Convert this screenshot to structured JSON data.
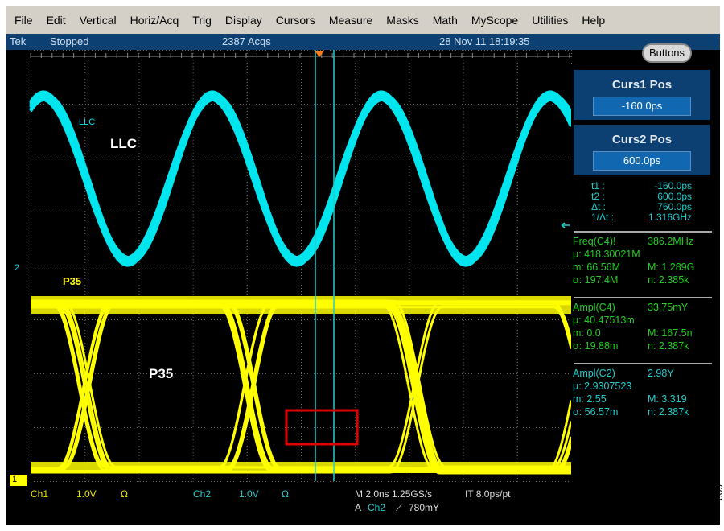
{
  "menu": [
    "File",
    "Edit",
    "Vertical",
    "Horiz/Acq",
    "Trig",
    "Display",
    "Cursors",
    "Measure",
    "Masks",
    "Math",
    "MyScope",
    "Utilities",
    "Help"
  ],
  "status": {
    "brand": "Tek",
    "state": "Stopped",
    "acqs": "2387 Acqs",
    "datetime": "28 Nov 11 18:19:35"
  },
  "buttons_label": "Buttons",
  "cursors": {
    "c1_title": "Curs1 Pos",
    "c1_value": "-160.0ps",
    "c2_title": "Curs2 Pos",
    "c2_value": "600.0ps",
    "readout": [
      [
        "t1 :",
        "-160.0ps"
      ],
      [
        "t2 :",
        "600.0ps"
      ],
      [
        "Δt :",
        "760.0ps"
      ],
      [
        "1/Δt :",
        "1.316GHz"
      ]
    ]
  },
  "measurements": [
    {
      "color": "#22cc22",
      "rows": [
        [
          "Freq(C4)!",
          "386.2MHz"
        ],
        [
          "μ: 418.30021M",
          ""
        ],
        [
          "m: 66.56M",
          "M: 1.289G"
        ],
        [
          "σ: 197.4M",
          "n: 2.385k"
        ]
      ]
    },
    {
      "color": "#22cc22",
      "rows": [
        [
          "Ampl(C4)",
          "33.75mY"
        ],
        [
          "μ: 40.47513m",
          ""
        ],
        [
          "m: 0.0",
          "M: 167.5n"
        ],
        [
          "σ: 19.88m",
          "n: 2.387k"
        ]
      ]
    },
    {
      "color": "#22cccc",
      "rows": [
        [
          "Ampl(C2)",
          "2.98Y"
        ],
        [
          "μ: 2.9307523",
          ""
        ],
        [
          "m: 2.55",
          "M: 3.319"
        ],
        [
          "σ: 56.57m",
          "n: 2.387k"
        ]
      ]
    }
  ],
  "labels": {
    "llc_small": "LLC",
    "llc": "LLC",
    "p35_small": "P35",
    "p35": "P35",
    "ch2_marker": "2",
    "ch1_marker": "1"
  },
  "footer": {
    "ch1": "Ch1",
    "ch1_scale": "1.0V",
    "ch1_term": "Ω",
    "ch2": "Ch2",
    "ch2_scale": "1.0V",
    "ch2_term": "Ω",
    "horiz": "M 2.0ns 1.25GS/s",
    "it": "IT 8.0ps/pt",
    "trig_a": "A",
    "trig_src": "Ch2",
    "trig_slope": "⟋",
    "trig_level": "780mY"
  },
  "figure_id": "10009-009",
  "colors": {
    "ch1": "#ffff00",
    "ch2": "#00e5ee",
    "cursor": "#22cccc",
    "box": "#e00000"
  }
}
